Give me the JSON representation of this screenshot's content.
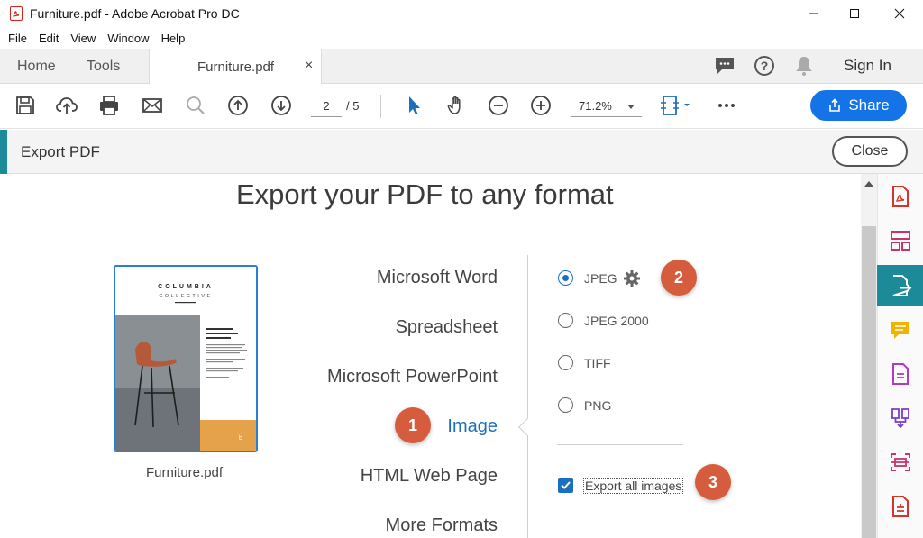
{
  "window": {
    "title": "Furniture.pdf - Adobe Acrobat Pro DC"
  },
  "menu": [
    "File",
    "Edit",
    "View",
    "Window",
    "Help"
  ],
  "tabs": {
    "home": "Home",
    "tools": "Tools",
    "document": "Furniture.pdf",
    "close_glyph": "×"
  },
  "header_right": {
    "sign_in": "Sign In"
  },
  "toolbar": {
    "current_page": "2",
    "page_total": "/ 5",
    "zoom": "71.2%",
    "share": "Share"
  },
  "export_panel": {
    "label": "Export PDF",
    "close": "Close"
  },
  "main": {
    "heading": "Export your PDF to any format",
    "thumbnail": {
      "filename": "Furniture.pdf",
      "brand_line1": "COLUMBIA",
      "brand_line2": "COLLECTIVE"
    },
    "formats": [
      "Microsoft Word",
      "Spreadsheet",
      "Microsoft PowerPoint",
      "Image",
      "HTML Web Page",
      "More Formats"
    ],
    "selected_format": "Image",
    "image_options": [
      "JPEG",
      "JPEG 2000",
      "TIFF",
      "PNG"
    ],
    "selected_image_option": "JPEG",
    "export_all_images": {
      "label": "Export all images",
      "checked": true
    }
  },
  "steps": [
    "1",
    "2",
    "3"
  ],
  "colors": {
    "accent_blue": "#1473e6",
    "teal": "#1c8a99",
    "step_badge": "#d65c3e",
    "selected_text": "#1c6fbf"
  },
  "rail_icons": [
    "create-pdf-icon",
    "organize-pages-icon",
    "export-pdf-icon",
    "comment-icon",
    "edit-pdf-icon",
    "combine-files-icon",
    "scan-icon",
    "more-tools-icon"
  ]
}
